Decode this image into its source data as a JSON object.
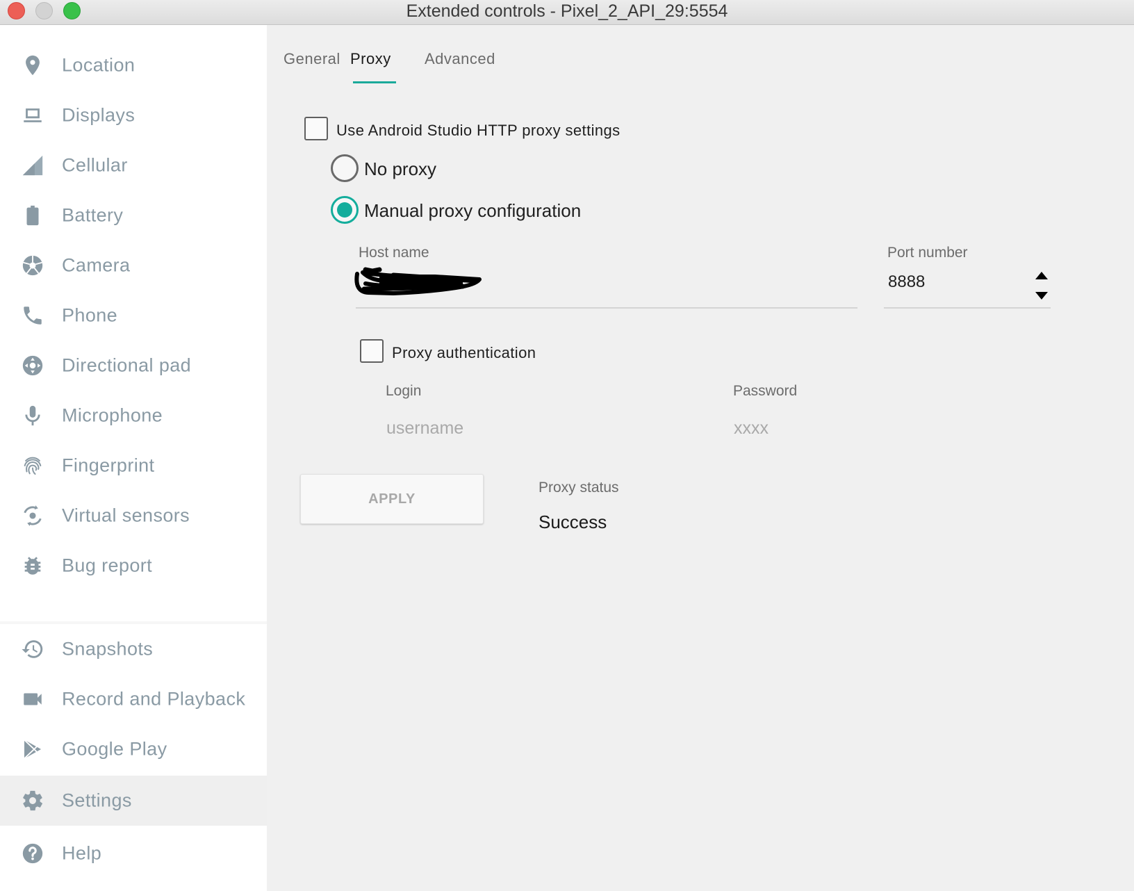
{
  "window": {
    "title": "Extended controls - Pixel_2_API_29:5554",
    "close_color": "#ec5f56",
    "maximize_color": "#39c14a"
  },
  "sidebar": {
    "items": [
      {
        "label": "Location",
        "icon": "location-pin-icon"
      },
      {
        "label": "Displays",
        "icon": "laptop-display-icon"
      },
      {
        "label": "Cellular",
        "icon": "cellular-signal-icon"
      },
      {
        "label": "Battery",
        "icon": "battery-icon"
      },
      {
        "label": "Camera",
        "icon": "camera-shutter-icon"
      },
      {
        "label": "Phone",
        "icon": "phone-icon"
      },
      {
        "label": "Directional pad",
        "icon": "dpad-icon"
      },
      {
        "label": "Microphone",
        "icon": "microphone-icon"
      },
      {
        "label": "Fingerprint",
        "icon": "fingerprint-icon"
      },
      {
        "label": "Virtual sensors",
        "icon": "virtual-sensors-icon"
      },
      {
        "label": "Bug report",
        "icon": "bug-icon"
      },
      {
        "label": "Snapshots",
        "icon": "history-icon"
      },
      {
        "label": "Record and Playback",
        "icon": "video-camera-icon"
      },
      {
        "label": "Google Play",
        "icon": "play-store-icon"
      },
      {
        "label": "Settings",
        "icon": "gear-icon",
        "selected": true
      },
      {
        "label": "Help",
        "icon": "help-icon"
      }
    ]
  },
  "tabs": [
    {
      "label": "General"
    },
    {
      "label": "Proxy",
      "active": true
    },
    {
      "label": "Advanced"
    }
  ],
  "proxy": {
    "use_studio_label": "Use Android Studio HTTP proxy settings",
    "use_studio_checked": false,
    "no_proxy_label": "No proxy",
    "manual_label": "Manual proxy configuration",
    "selected_mode": "manual",
    "host_label": "Host name",
    "port_label": "Port number",
    "port_value": "8888",
    "auth_label": "Proxy authentication",
    "auth_checked": false,
    "login_label": "Login",
    "login_placeholder": "username",
    "password_label": "Password",
    "password_placeholder": "xxxx",
    "apply_label": "APPLY",
    "status_label": "Proxy status",
    "status_value": "Success"
  },
  "colors": {
    "accent": "#14ad9c",
    "sidebar_text": "#8a9aa4"
  }
}
